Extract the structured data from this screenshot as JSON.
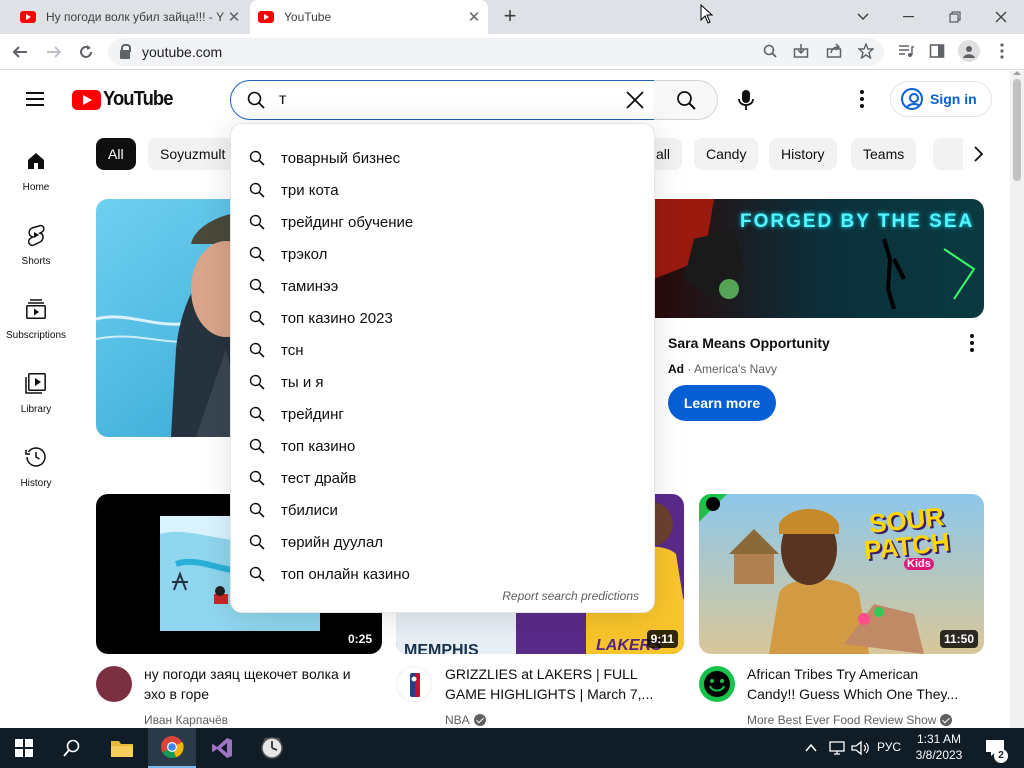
{
  "browser": {
    "tabs": [
      {
        "title": "Ну погоди волк убил зайца!!! - Y"
      },
      {
        "title": "YouTube"
      }
    ],
    "new_tab": "+",
    "url": "youtube.com"
  },
  "youtube": {
    "logo_text": "YouTube",
    "search_query": "т",
    "sign_in": "Sign in",
    "sidebar": [
      {
        "label": "Home"
      },
      {
        "label": "Shorts"
      },
      {
        "label": "Subscriptions"
      },
      {
        "label": "Library"
      },
      {
        "label": "History"
      }
    ],
    "chips": [
      "All",
      "Soyuzmult",
      "all",
      "Candy",
      "History",
      "Teams"
    ],
    "suggestions": [
      "товарный бизнес",
      "три кота",
      "трейдинг обучение",
      "трэкол",
      "таминээ",
      "топ казино 2023",
      "тсн",
      "ты и я",
      "трейдинг",
      "топ казино",
      "тест драйв",
      "тбилиси",
      "төрийн дуулал",
      "топ онлайн казино"
    ],
    "report_predictions": "Report search predictions",
    "ad": {
      "banner_text": "FORGED BY THE SEA",
      "title": "Sara Means Opportunity",
      "badge": "Ad",
      "advertiser": "America's Navy",
      "cta": "Learn more"
    },
    "videos": [
      {
        "title_line1": "ну погоди заяц щекочет волка и",
        "title_line2": "эхо в горе",
        "channel": "Иван Карпачёв",
        "duration": "0:25"
      },
      {
        "title_line1": "GRIZZLIES at LAKERS | FULL",
        "title_line2": "GAME HIGHLIGHTS | March 7,...",
        "channel": "NBA",
        "duration": "9:11",
        "jersey_left": "MEMPHIS",
        "jersey_right": "LAKERS"
      },
      {
        "title_line1": "African Tribes Try American",
        "title_line2": "Candy!! Guess Which One They...",
        "channel": "More Best Ever Food Review Show",
        "duration": "11:50",
        "brand_line1": "SOUR",
        "brand_line2": "PATCH",
        "brand_line3": "Kids"
      }
    ]
  },
  "taskbar": {
    "language": "РУС",
    "time": "1:31 AM",
    "date": "3/8/2023",
    "notifications": "2"
  },
  "colors": {
    "accent_blue": "#065fd4",
    "youtube_red": "#ff0000",
    "taskbar": "#101c26"
  }
}
